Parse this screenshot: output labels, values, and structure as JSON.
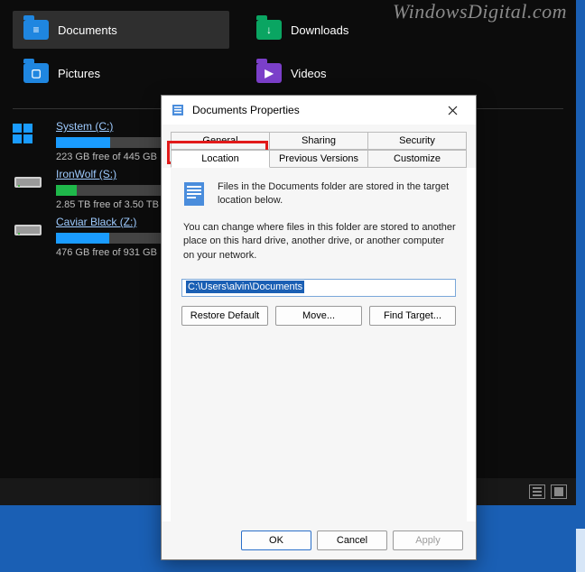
{
  "watermark": "WindowsDigital.com",
  "libraries": [
    {
      "label": "Documents",
      "icon": "folder-blue",
      "glyph": "≡",
      "selected": true
    },
    {
      "label": "Downloads",
      "icon": "folder-green",
      "glyph": "↓",
      "selected": false
    },
    {
      "label": "Pictures",
      "icon": "folder-blue",
      "glyph": "▢",
      "selected": false
    },
    {
      "label": "Videos",
      "icon": "folder-purple",
      "glyph": "▶",
      "selected": false
    }
  ],
  "drives": [
    {
      "name": "System (C:)",
      "free": "223 GB free of 445 GB",
      "used_pct": 50,
      "color": "#1a9cff",
      "is_system": true
    },
    {
      "name": "IronWolf (S:)",
      "free": "2.85 TB free of 3.50 TB",
      "used_pct": 19,
      "color": "#1fb84a",
      "is_system": false
    },
    {
      "name": "Caviar Black (Z:)",
      "free": "476 GB free of 931 GB",
      "used_pct": 49,
      "color": "#1a9cff",
      "is_system": false
    }
  ],
  "dialog": {
    "title": "Documents Properties",
    "tabs_row1": [
      "General",
      "Sharing",
      "Security"
    ],
    "tabs_row2": [
      "Location",
      "Previous Versions",
      "Customize"
    ],
    "active_tab": "Location",
    "desc1": "Files in the Documents folder are stored in the target location below.",
    "desc2": "You can change where files in this folder are stored to another place on this hard drive, another drive, or another computer on your network.",
    "path": "C:\\Users\\alvin\\Documents",
    "buttons": {
      "restore": "Restore Default",
      "move": "Move...",
      "find": "Find Target..."
    },
    "footer": {
      "ok": "OK",
      "cancel": "Cancel",
      "apply": "Apply"
    }
  }
}
